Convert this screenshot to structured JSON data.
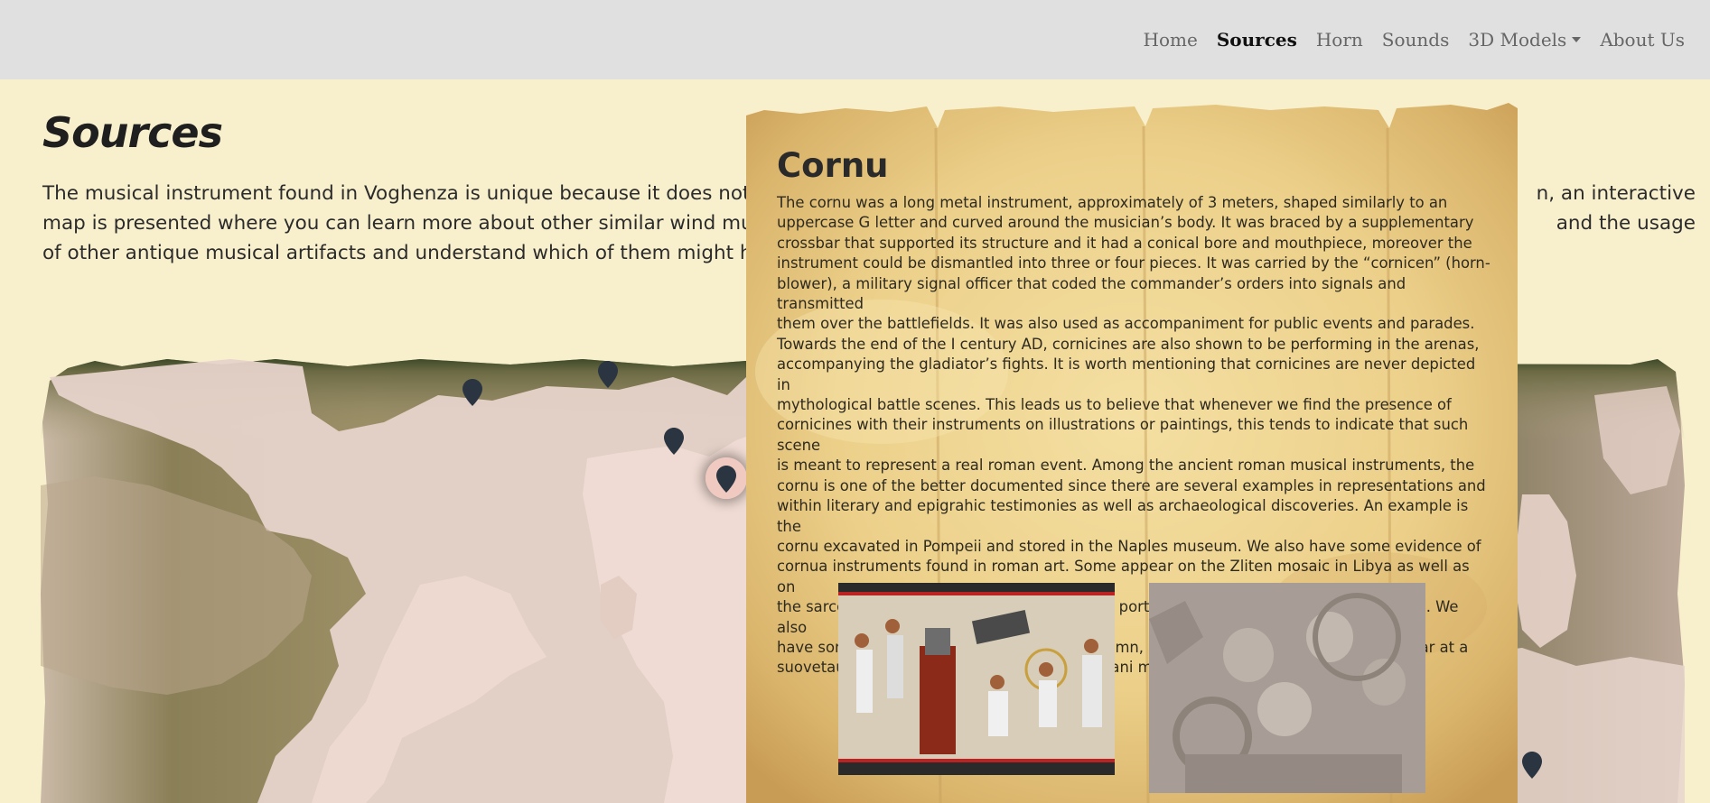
{
  "nav": {
    "items": [
      {
        "label": "Home",
        "active": false
      },
      {
        "label": "Sources",
        "active": true
      },
      {
        "label": "Horn",
        "active": false
      },
      {
        "label": "Sounds",
        "active": false
      },
      {
        "label": "3D Models",
        "active": false,
        "dropdown": true
      },
      {
        "label": "About Us",
        "active": false
      }
    ]
  },
  "page": {
    "title": "Sources",
    "intro_line1": "The musical instrument found in Voghenza is unique because it does not see",
    "intro_line1_end": "n, an interactive",
    "intro_line2": "map is presented where you can learn more about other similar wind music",
    "intro_line2_end": "and the usage",
    "intro_line3": "of other antique musical artifacts and understand which of them might have"
  },
  "popup": {
    "title": "Cornu",
    "body": [
      "The cornu was a long metal instrument, approximately of 3 meters, shaped similarly to an",
      "uppercase G letter and curved around the musician’s body. It was braced by a supplementary",
      "crossbar that supported its structure and it had a conical bore and mouthpiece, moreover the",
      "instrument could be dismantled into three or four pieces. It was carried by the “cornicen” (horn-",
      "blower), a military signal officer that coded the commander’s orders into signals and transmitted",
      "them over the battlefields. It was also used as accompaniment for public events and parades.",
      "Towards the end of the I century AD, cornicines are also shown to be performing in the arenas,",
      "accompanying the gladiator’s fights. It is worth mentioning that cornicines are never depicted in",
      "mythological battle scenes. This leads us to believe that whenever we find the presence of",
      "cornicines with their instruments on illustrations or paintings, this tends to indicate that such scene",
      "is meant to represent a real roman event. Among the ancient roman musical instruments, the",
      "cornu is one of the better documented since there are several examples in representations and",
      "within literary and epigrahic testimonies as well as archaeological discoveries. An example is the",
      "cornu excavated in Pompeii and stored in the Naples museum. We also have some evidence of",
      "cornua instruments found in roman art. Some appear on the Zliten mosaic in Libya as well as on",
      "the sarcophagus from Caere where a cornu is portrayed together with a lyre and a tibia. We also",
      "have some evidence of it on the Trajan’s Column, where a tuba and three cornua appear at a",
      "suovetaurilia as well as on the Tropaeum Traiani monument."
    ],
    "images": [
      "mosaic-image",
      "relief-image"
    ]
  },
  "colors": {
    "page_bg": "#f8f0cd",
    "nav_bg": "#e0e0e0",
    "pin": "#2b3542",
    "land": "#e8d5cc",
    "sea": "#7a6e48"
  }
}
